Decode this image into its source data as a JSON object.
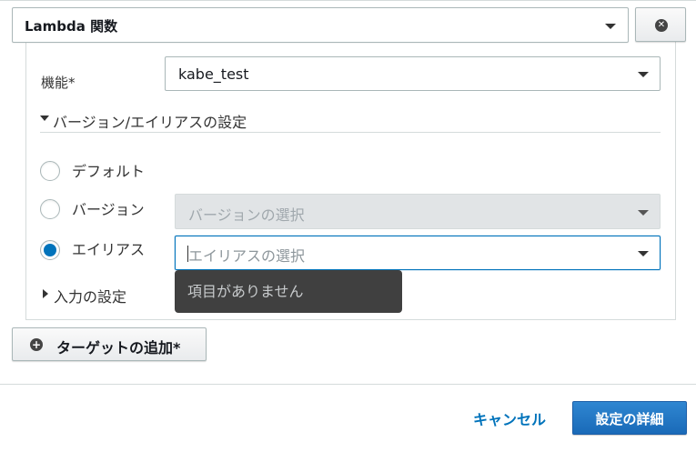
{
  "target_block": {
    "title": "Lambda 関数",
    "remove_icon": "close-circle-icon"
  },
  "function_field": {
    "label": "機能*",
    "value": "kabe_test"
  },
  "version_alias_section": {
    "title": "バージョン/エイリアスの設定",
    "expanded": true,
    "options": [
      {
        "label": "デフォルト",
        "selected": false
      },
      {
        "label": "バージョン",
        "selected": false
      },
      {
        "label": "エイリアス",
        "selected": true
      }
    ],
    "version_select": {
      "placeholder": "バージョンの選択",
      "disabled": true
    },
    "alias_select": {
      "placeholder": "エイリアスの選択",
      "focused": true
    },
    "alias_dropdown_empty": "項目がありません"
  },
  "input_section": {
    "title": "入力の設定",
    "expanded": false
  },
  "add_target": {
    "label": "ターゲットの追加*",
    "icon": "plus-circle-icon"
  },
  "footer": {
    "cancel_label": "キャンセル",
    "configure_label": "設定の詳細"
  },
  "colors": {
    "accent": "#0073bb",
    "primary_button": "#1a6ab8",
    "tooltip_bg": "#404040",
    "border": "#aab7b8"
  }
}
